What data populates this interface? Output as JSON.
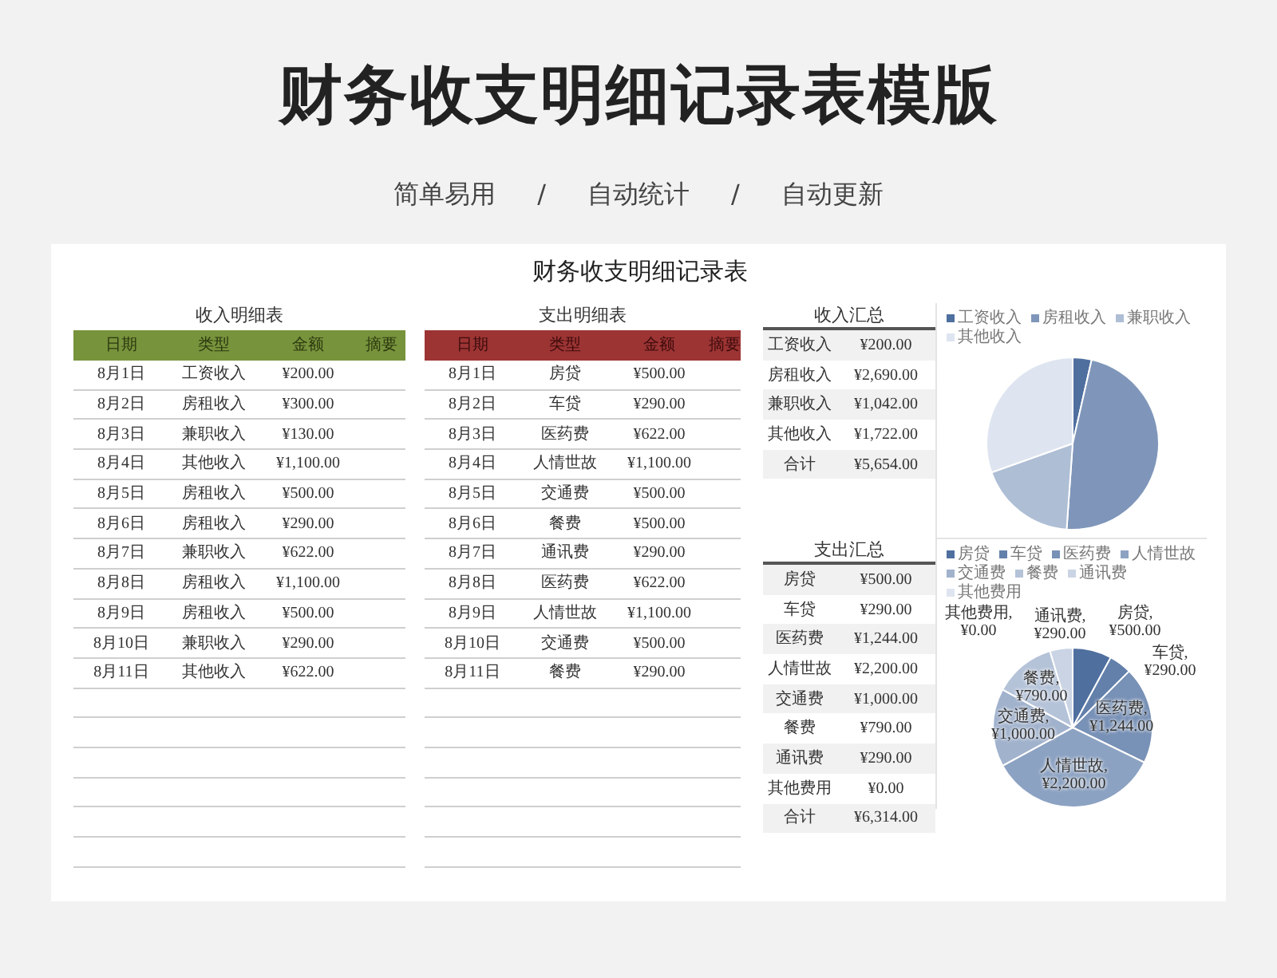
{
  "page": {
    "title": "财务收支明细记录表模版",
    "tagline": [
      "简单易用",
      "/",
      "自动统计",
      "/",
      "自动更新"
    ]
  },
  "sheet": {
    "title": "财务收支明细记录表",
    "income_table": {
      "kind": "income",
      "title": "收入明细表",
      "columns": [
        "日期",
        "类型",
        "金额",
        "摘要"
      ],
      "rows": [
        {
          "date": "8月1日",
          "type": "工资收入",
          "amount": "¥200.00"
        },
        {
          "date": "8月2日",
          "type": "房租收入",
          "amount": "¥300.00"
        },
        {
          "date": "8月3日",
          "type": "兼职收入",
          "amount": "¥130.00"
        },
        {
          "date": "8月4日",
          "type": "其他收入",
          "amount": "¥1,100.00"
        },
        {
          "date": "8月5日",
          "type": "房租收入",
          "amount": "¥500.00"
        },
        {
          "date": "8月6日",
          "type": "房租收入",
          "amount": "¥290.00"
        },
        {
          "date": "8月7日",
          "type": "兼职收入",
          "amount": "¥622.00"
        },
        {
          "date": "8月8日",
          "type": "房租收入",
          "amount": "¥1,100.00"
        },
        {
          "date": "8月9日",
          "type": "房租收入",
          "amount": "¥500.00"
        },
        {
          "date": "8月10日",
          "type": "兼职收入",
          "amount": "¥290.00"
        },
        {
          "date": "8月11日",
          "type": "其他收入",
          "amount": "¥622.00"
        }
      ]
    },
    "expense_table": {
      "kind": "expense",
      "title": "支出明细表",
      "columns": [
        "日期",
        "类型",
        "金额",
        "摘要"
      ],
      "rows": [
        {
          "date": "8月1日",
          "type": "房贷",
          "amount": "¥500.00"
        },
        {
          "date": "8月2日",
          "type": "车贷",
          "amount": "¥290.00"
        },
        {
          "date": "8月3日",
          "type": "医药费",
          "amount": "¥622.00"
        },
        {
          "date": "8月4日",
          "type": "人情世故",
          "amount": "¥1,100.00"
        },
        {
          "date": "8月5日",
          "type": "交通费",
          "amount": "¥500.00"
        },
        {
          "date": "8月6日",
          "type": "餐费",
          "amount": "¥500.00"
        },
        {
          "date": "8月7日",
          "type": "通讯费",
          "amount": "¥290.00"
        },
        {
          "date": "8月8日",
          "type": "医药费",
          "amount": "¥622.00"
        },
        {
          "date": "8月9日",
          "type": "人情世故",
          "amount": "¥1,100.00"
        },
        {
          "date": "8月10日",
          "type": "交通费",
          "amount": "¥500.00"
        },
        {
          "date": "8月11日",
          "type": "餐费",
          "amount": "¥290.00"
        }
      ]
    },
    "income_summary": {
      "title": "收入汇总",
      "rows": [
        {
          "label": "工资收入",
          "amount": "¥200.00"
        },
        {
          "label": "房租收入",
          "amount": "¥2,690.00"
        },
        {
          "label": "兼职收入",
          "amount": "¥1,042.00"
        },
        {
          "label": "其他收入",
          "amount": "¥1,722.00"
        },
        {
          "label": "合计",
          "amount": "¥5,654.00"
        }
      ],
      "chart_data": {
        "type": "pie",
        "legend": true,
        "categories": [
          "工资收入",
          "房租收入",
          "兼职收入",
          "其他收入"
        ],
        "values": [
          3.54,
          47.58,
          18.43,
          30.45
        ]
      }
    },
    "expense_summary": {
      "title": "支出汇总",
      "rows": [
        {
          "label": "房贷",
          "amount": "¥500.00"
        },
        {
          "label": "车贷",
          "amount": "¥290.00"
        },
        {
          "label": "医药费",
          "amount": "¥1,244.00"
        },
        {
          "label": "人情世故",
          "amount": "¥2,200.00"
        },
        {
          "label": "交通费",
          "amount": "¥1,000.00"
        },
        {
          "label": "餐费",
          "amount": "¥790.00"
        },
        {
          "label": "通讯费",
          "amount": "¥290.00"
        },
        {
          "label": "其他费用",
          "amount": "¥0.00"
        },
        {
          "label": "合计",
          "amount": "¥6,314.00"
        }
      ],
      "chart_data": {
        "type": "pie",
        "legend": true,
        "categories": [
          "房贷",
          "车贷",
          "医药费",
          "人情世故",
          "交通费",
          "餐费",
          "通讯费",
          "其他费用"
        ],
        "values": [
          500,
          290,
          1244,
          2200,
          1000,
          790,
          290,
          0
        ],
        "value_labels": [
          "房贷,¥500.00",
          "车贷,¥290.00",
          "医药费,¥1,244.00",
          "人情世故,¥2,200.00",
          "交通费,¥1,000.00",
          "餐费,¥790.00",
          "通讯费,¥290.00",
          "其他费用,¥0.00"
        ]
      }
    }
  }
}
